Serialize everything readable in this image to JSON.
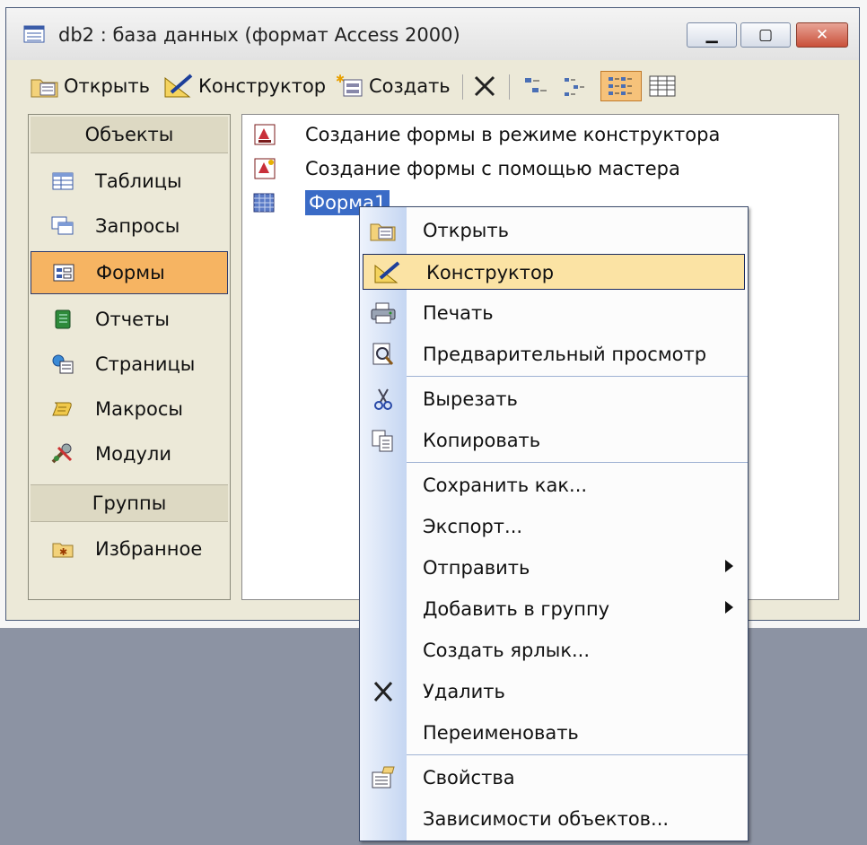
{
  "window": {
    "title": "db2 : база данных (формат Access 2000)",
    "buttons": {
      "minimize": "▁",
      "maximize": "▢",
      "close": "✕"
    }
  },
  "toolbar": {
    "open_label": "Открыть",
    "design_label": "Конструктор",
    "create_label": "Создать",
    "delete_icon": "delete-icon",
    "view_icons": [
      "large-icons-view-icon",
      "small-icons-view-icon",
      "list-view-icon",
      "details-view-icon"
    ]
  },
  "sidebar": {
    "objects_header": "Объекты",
    "items": [
      {
        "label": "Таблицы",
        "icon": "table-icon"
      },
      {
        "label": "Запросы",
        "icon": "query-icon"
      },
      {
        "label": "Формы",
        "icon": "form-icon",
        "selected": true
      },
      {
        "label": "Отчеты",
        "icon": "report-icon"
      },
      {
        "label": "Страницы",
        "icon": "page-icon"
      },
      {
        "label": "Макросы",
        "icon": "macro-icon"
      },
      {
        "label": "Модули",
        "icon": "module-icon"
      }
    ],
    "groups_header": "Группы",
    "groups": [
      {
        "label": "Избранное",
        "icon": "favorites-icon"
      }
    ]
  },
  "list": {
    "items": [
      {
        "label": "Создание формы в режиме конструктора",
        "icon": "new-form-design-icon"
      },
      {
        "label": "Создание формы с помощью мастера",
        "icon": "new-form-wizard-icon"
      },
      {
        "label": "Форма1",
        "icon": "form-object-icon",
        "selected": true
      }
    ]
  },
  "context_menu": {
    "items": [
      {
        "label": "Открыть",
        "icon": "open-icon"
      },
      {
        "label": "Конструктор",
        "icon": "design-icon",
        "highlighted": true
      },
      {
        "label": "Печать",
        "icon": "print-icon"
      },
      {
        "label": "Предварительный просмотр",
        "icon": "preview-icon"
      },
      {
        "label": "Вырезать",
        "icon": "cut-icon"
      },
      {
        "label": "Копировать",
        "icon": "copy-icon"
      },
      {
        "label": "Сохранить как...",
        "icon": ""
      },
      {
        "label": "Экспорт...",
        "icon": ""
      },
      {
        "label": "Отправить",
        "icon": "",
        "submenu": true
      },
      {
        "label": "Добавить в группу",
        "icon": "",
        "submenu": true
      },
      {
        "label": "Создать ярлык...",
        "icon": ""
      },
      {
        "label": "Удалить",
        "icon": "delete-icon"
      },
      {
        "label": "Переименовать",
        "icon": ""
      },
      {
        "label": "Свойства",
        "icon": "properties-icon"
      },
      {
        "label": "Зависимости объектов...",
        "icon": ""
      }
    ]
  },
  "colors": {
    "selected_nav": "#f6b462",
    "menu_highlight": "#fbe3a4",
    "list_selection": "#3a6bc6",
    "menu_strip": "#c5d6f2"
  }
}
